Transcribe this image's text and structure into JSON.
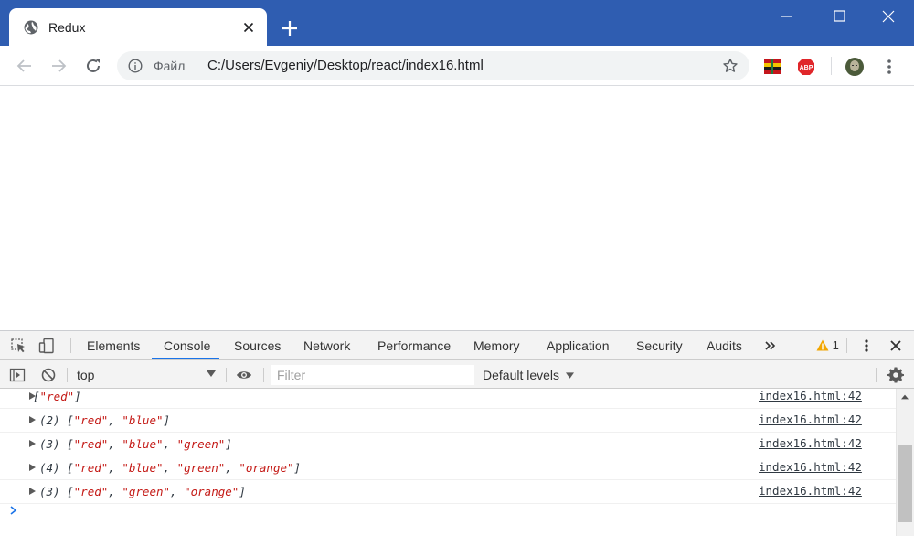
{
  "browser": {
    "tab_title": "Redux",
    "address": {
      "site_label": "Файл",
      "url": "C:/Users/Evgeniy/Desktop/react/index16.html"
    }
  },
  "devtools": {
    "tabs": [
      "Elements",
      "Console",
      "Sources",
      "Network",
      "Performance",
      "Memory",
      "Application",
      "Security",
      "Audits"
    ],
    "active_tab": "Console",
    "warning_count": "1",
    "context": "top",
    "filter_placeholder": "Filter",
    "levels_label": "Default levels",
    "logs": [
      {
        "count": "",
        "message": "[\"red\"]",
        "source": "index16.html:42"
      },
      {
        "count": "(2)",
        "message": "[\"red\", \"blue\"]",
        "source": "index16.html:42"
      },
      {
        "count": "(3)",
        "message": "[\"red\", \"blue\", \"green\"]",
        "source": "index16.html:42"
      },
      {
        "count": "(4)",
        "message": "[\"red\", \"blue\", \"green\", \"orange\"]",
        "source": "index16.html:42"
      },
      {
        "count": "(3)",
        "message": "[\"red\", \"green\", \"orange\"]",
        "source": "index16.html:42"
      }
    ]
  },
  "colors": {
    "titlebar": "#2f5db1",
    "string": "#c41a16",
    "accent": "#1a73e8"
  }
}
